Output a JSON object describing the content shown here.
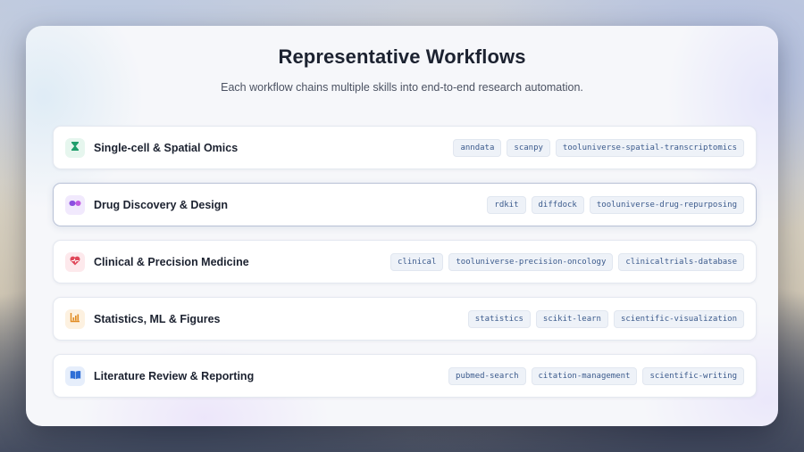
{
  "header": {
    "title": "Representative Workflows",
    "subtitle": "Each workflow chains multiple skills into end-to-end research automation."
  },
  "workflows": [
    {
      "label": "Single-cell & Spatial Omics",
      "icon": "hourglass-icon",
      "icon_color": "#1f9d6b",
      "icon_bg": "#e6f6ee",
      "tags": [
        "anndata",
        "scanpy",
        "tooluniverse-spatial-transcriptomics"
      ]
    },
    {
      "label": "Drug Discovery & Design",
      "icon": "pills-icon",
      "icon_color": "#8b4fe0",
      "icon_bg": "#f1e9fd",
      "tags": [
        "rdkit",
        "diffdock",
        "tooluniverse-drug-repurposing"
      ]
    },
    {
      "label": "Clinical & Precision Medicine",
      "icon": "heart-pulse-icon",
      "icon_color": "#e0485a",
      "icon_bg": "#fde9ec",
      "tags": [
        "clinical",
        "tooluniverse-precision-oncology",
        "clinicaltrials-database"
      ]
    },
    {
      "label": "Statistics, ML & Figures",
      "icon": "bar-chart-icon",
      "icon_color": "#e08a1f",
      "icon_bg": "#fdf1e0",
      "tags": [
        "statistics",
        "scikit-learn",
        "scientific-visualization"
      ]
    },
    {
      "label": "Literature Review & Reporting",
      "icon": "book-icon",
      "icon_color": "#2f6fd6",
      "icon_bg": "#e6eefb",
      "tags": [
        "pubmed-search",
        "citation-management",
        "scientific-writing"
      ]
    }
  ]
}
